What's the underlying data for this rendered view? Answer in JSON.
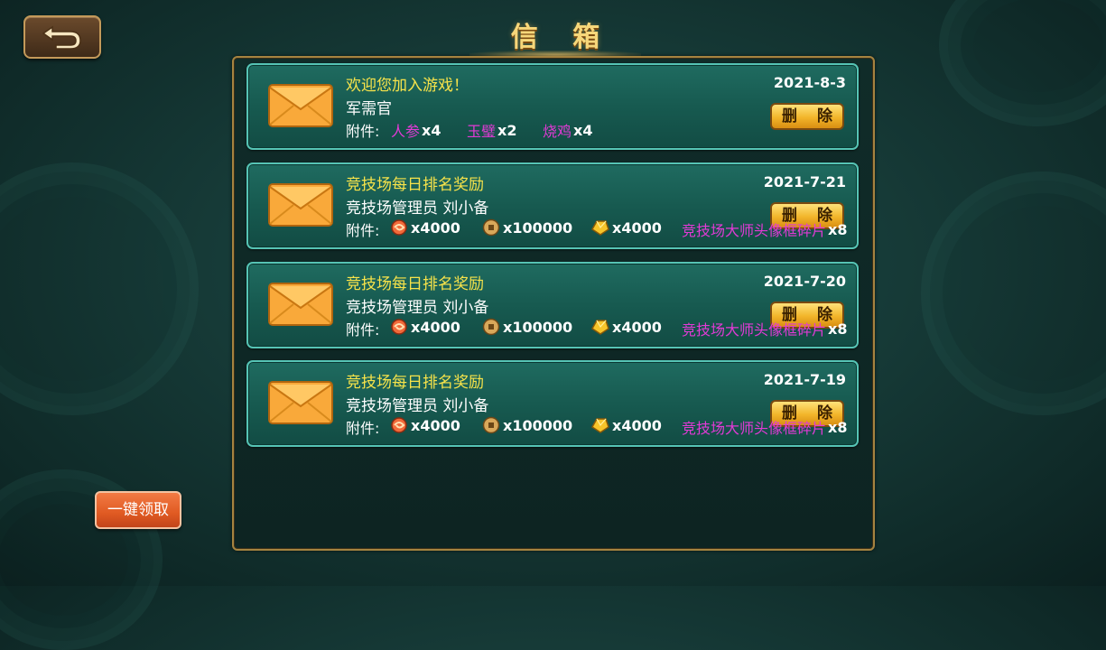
{
  "header": {
    "title": "信 箱",
    "back_icon": "back-arrow-icon"
  },
  "mails": [
    {
      "title": "欢迎您加入游戏！",
      "sender": "军需官",
      "date": "2021-8-3",
      "attachment_label": "附件:",
      "delete_label": "删 除",
      "attachments": [
        {
          "name": "人参",
          "qty": "x4"
        },
        {
          "name": "玉璧",
          "qty": "x2"
        },
        {
          "name": "烧鸡",
          "qty": "x4"
        }
      ]
    },
    {
      "title": "竞技场每日排名奖励",
      "sender": "竞技场管理员 刘小备",
      "date": "2021-7-21",
      "attachment_label": "附件:",
      "delete_label": "删 除",
      "attachments": [
        {
          "icon": "candy-icon",
          "qty": "x4000"
        },
        {
          "icon": "coin-icon",
          "qty": "x100000"
        },
        {
          "icon": "gold-ingot-icon",
          "qty": "x4000"
        },
        {
          "name": "竞技场大师头像框碎片",
          "qty": "x8"
        }
      ]
    },
    {
      "title": "竞技场每日排名奖励",
      "sender": "竞技场管理员 刘小备",
      "date": "2021-7-20",
      "attachment_label": "附件:",
      "delete_label": "删 除",
      "attachments": [
        {
          "icon": "candy-icon",
          "qty": "x4000"
        },
        {
          "icon": "coin-icon",
          "qty": "x100000"
        },
        {
          "icon": "gold-ingot-icon",
          "qty": "x4000"
        },
        {
          "name": "竞技场大师头像框碎片",
          "qty": "x8"
        }
      ]
    },
    {
      "title": "竞技场每日排名奖励",
      "sender": "竞技场管理员 刘小备",
      "date": "2021-7-19",
      "attachment_label": "附件:",
      "delete_label": "删 除",
      "attachments": [
        {
          "icon": "candy-icon",
          "qty": "x4000"
        },
        {
          "icon": "coin-icon",
          "qty": "x100000"
        },
        {
          "icon": "gold-ingot-icon",
          "qty": "x4000"
        },
        {
          "name": "竞技场大师头像框碎片",
          "qty": "x8"
        }
      ]
    }
  ],
  "footer": {
    "claim_all_label": "一键领取"
  }
}
